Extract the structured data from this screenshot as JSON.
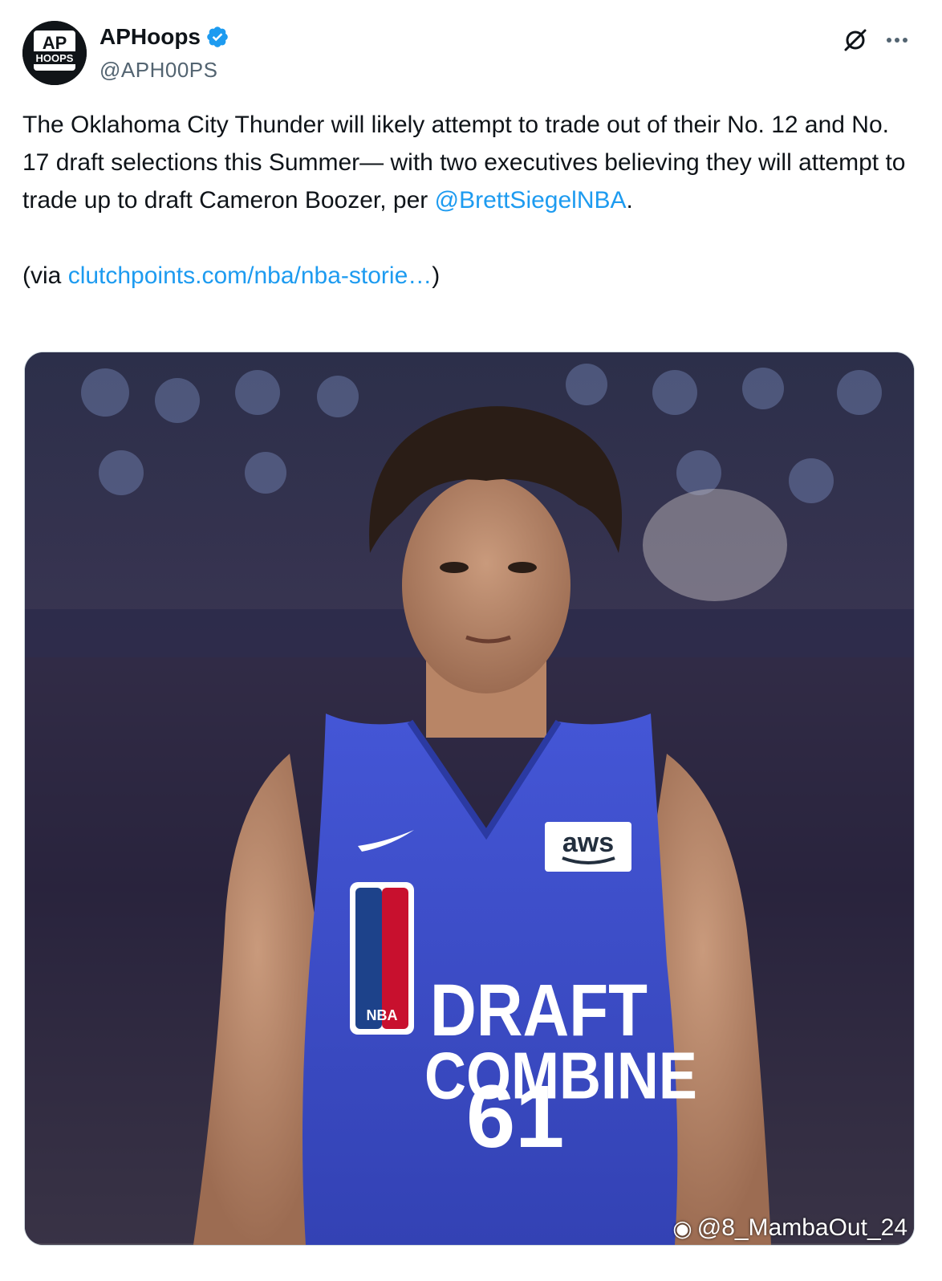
{
  "author": {
    "display_name": "APHoops",
    "handle": "@APH00PS",
    "verified": true,
    "avatar_logo_top": "AP",
    "avatar_logo_bottom": "HOOPS"
  },
  "tweet": {
    "line1_text": "The Oklahoma City Thunder will likely attempt to trade out of their No. 12 and No. 17 draft selections this Summer— with two executives believing they will attempt to trade up to draft Cameron Boozer, per ",
    "mention": "@BrettSiegelNBA",
    "line1_end": ".",
    "via_prefix": "(via ",
    "via_link": "clutchpoints.com/nba/nba-storie…",
    "via_suffix": ")"
  },
  "media": {
    "jersey_text_1": "DRAFT",
    "jersey_text_2": "COMBINE",
    "jersey_number": "61",
    "jersey_badge": "aws",
    "jersey_logo_text": "NBA",
    "watermark": "@8_MambaOut_24",
    "jersey_color": "#3e4fc8"
  },
  "colors": {
    "link": "#1d9bf0",
    "verified": "#1d9bf0",
    "text": "#0f1419",
    "muted": "#536471"
  },
  "icons": {
    "verified": "verified-badge-icon",
    "grok": "grok-icon",
    "more": "more-options-icon"
  }
}
